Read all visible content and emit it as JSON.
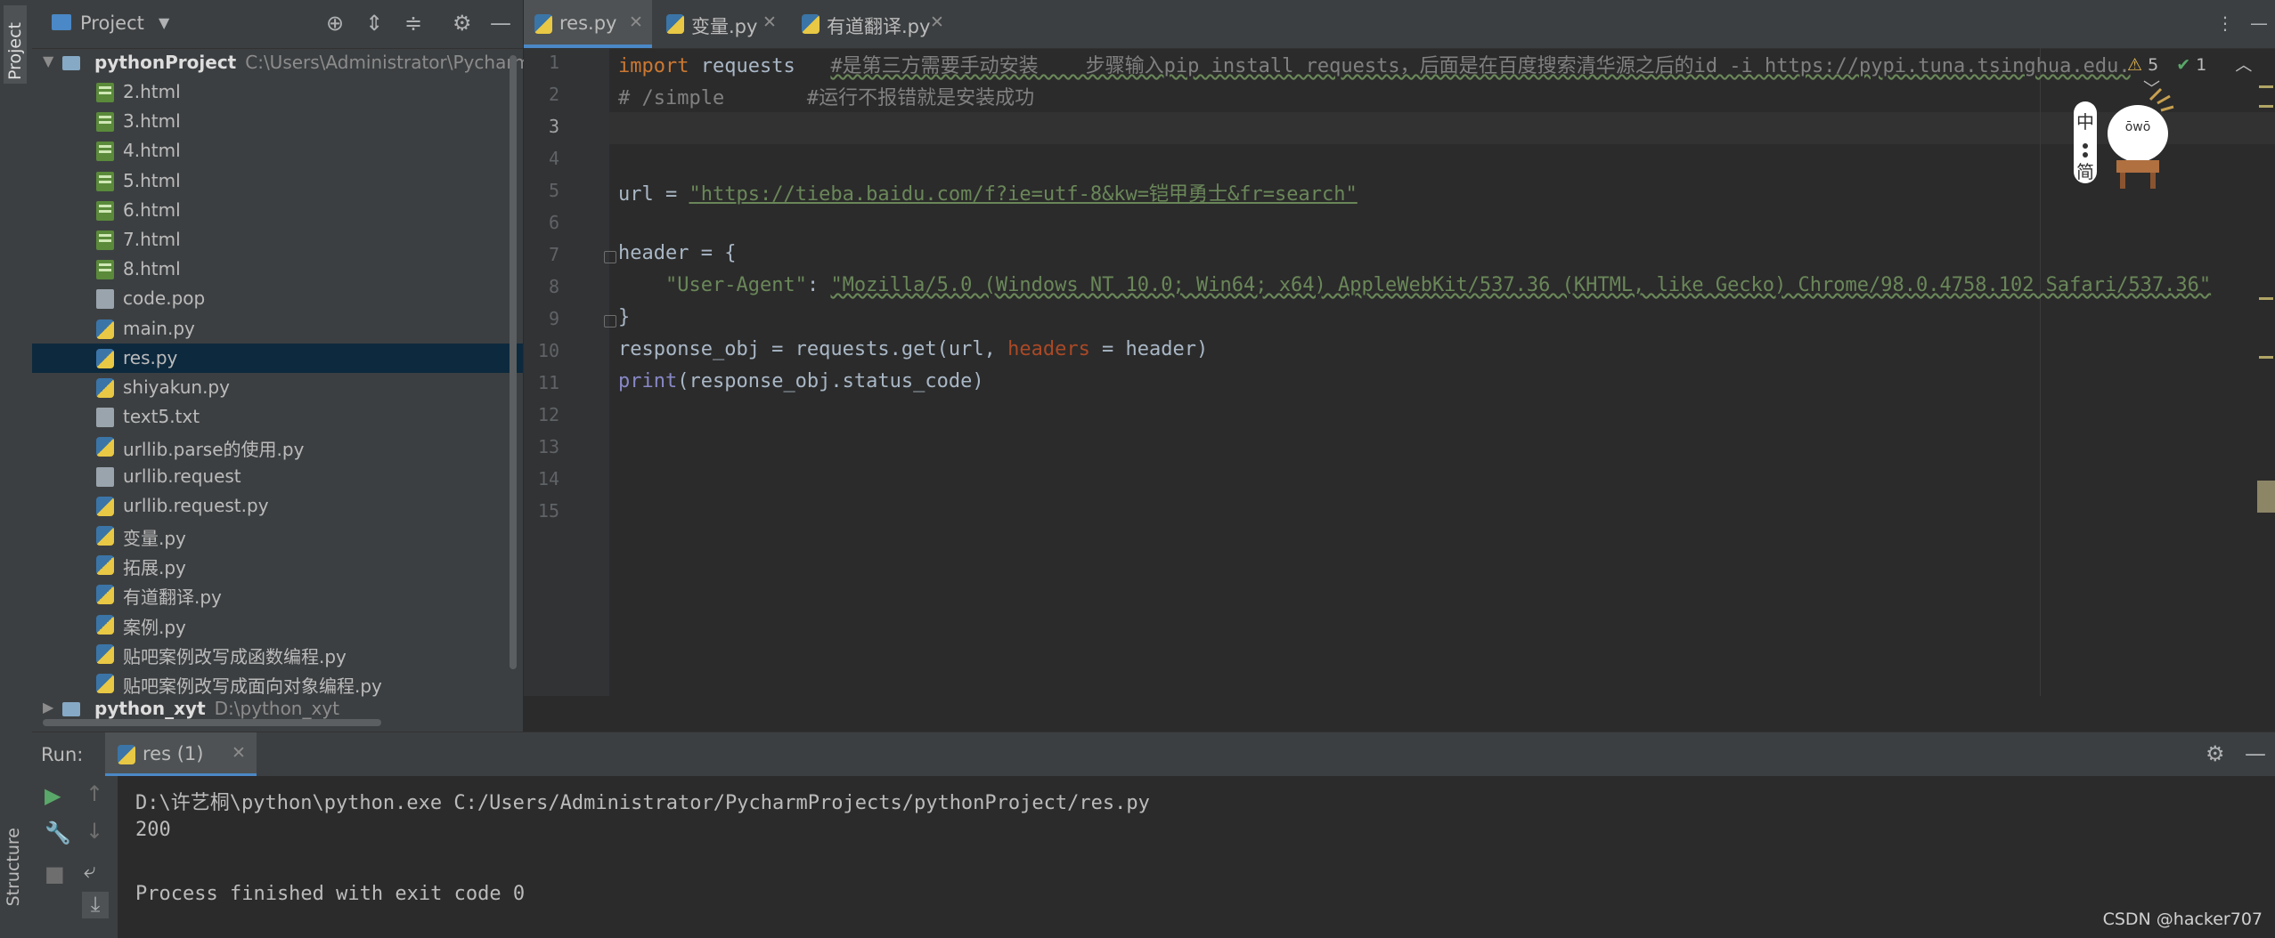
{
  "left_strip": {
    "project_tab": "Project",
    "structure_tab": "Structure"
  },
  "project_panel": {
    "title": "Project",
    "root": {
      "name": "pythonProject",
      "path": "C:\\Users\\Administrator\\PycharmP"
    },
    "files": [
      {
        "name": "2.html",
        "type": "html"
      },
      {
        "name": "3.html",
        "type": "html"
      },
      {
        "name": "4.html",
        "type": "html"
      },
      {
        "name": "5.html",
        "type": "html"
      },
      {
        "name": "6.html",
        "type": "html"
      },
      {
        "name": "7.html",
        "type": "html"
      },
      {
        "name": "8.html",
        "type": "html"
      },
      {
        "name": "code.pop",
        "type": "txt"
      },
      {
        "name": "main.py",
        "type": "py"
      },
      {
        "name": "res.py",
        "type": "py",
        "selected": true
      },
      {
        "name": "shiyakun.py",
        "type": "py"
      },
      {
        "name": "text5.txt",
        "type": "txt"
      },
      {
        "name": "urllib.parse的使用.py",
        "type": "py"
      },
      {
        "name": "urllib.request",
        "type": "txt"
      },
      {
        "name": "urllib.request.py",
        "type": "py"
      },
      {
        "name": "变量.py",
        "type": "py"
      },
      {
        "name": "拓展.py",
        "type": "py"
      },
      {
        "name": "有道翻译.py",
        "type": "py"
      },
      {
        "name": "案例.py",
        "type": "py"
      },
      {
        "name": "贴吧案例改写成函数编程.py",
        "type": "py"
      },
      {
        "name": "贴吧案例改写成面向对象编程.py",
        "type": "py"
      }
    ],
    "second_root": {
      "name": "python_xyt",
      "path": "D:\\python_xyt"
    }
  },
  "tabs": [
    {
      "label": "res.py",
      "active": true
    },
    {
      "label": "变量.py",
      "active": false
    },
    {
      "label": "有道翻译.py",
      "active": false
    }
  ],
  "editor": {
    "line_numbers": [
      "1",
      "2",
      "3",
      "4",
      "5",
      "6",
      "7",
      "8",
      "9",
      "10",
      "11",
      "12",
      "13",
      "14",
      "15"
    ],
    "current_line": "3",
    "code": {
      "l1_kw": "import",
      "l1_mod": " requests   ",
      "l1_comment": "#是第三方需要手动安装    步骤输入pip install requests，后面是在百度搜索清华源之后的id -i https://pypi.tuna.tsinghua.edu.",
      "l2_comment": "# /simple       #运行不报错就是安装成功",
      "l5_lhs": "url = ",
      "l5_str": "\"https://tieba.baidu.com/f?ie=utf-8&kw=铠甲勇士&fr=search\"",
      "l7": "header = {",
      "l8_key": "\"User-Agent\"",
      "l8_colon": ": ",
      "l8_val": "\"Mozilla/5.0 (Windows NT 10.0; Win64; x64) AppleWebKit/537.36 (KHTML, like Gecko) Chrome/98.0.4758.102 Safari/537.36\"",
      "l9": "}",
      "l10_a": "response_obj = requests.get(url, ",
      "l10_param": "headers",
      "l10_b": " = header)",
      "l11_fn": "print",
      "l11_rest": "(response_obj.status_code)"
    },
    "inspections": {
      "warnings": "5",
      "ok": "1"
    }
  },
  "mascot": {
    "text_top": "中",
    "text_bottom": "简",
    "face": "ōwō"
  },
  "run_panel": {
    "label": "Run:",
    "tab": "res (1)",
    "console": [
      "D:\\许艺桐\\python\\python.exe C:/Users/Administrator/PycharmProjects/pythonProject/res.py",
      "200",
      "",
      "Process finished with exit code 0"
    ]
  },
  "watermark": "CSDN @hacker707",
  "colors": {
    "background": "#2b2b2b",
    "panel": "#3c3f41",
    "keyword": "#cc7832",
    "string": "#6a8759",
    "comment": "#808080",
    "selection": "#0d293e"
  }
}
